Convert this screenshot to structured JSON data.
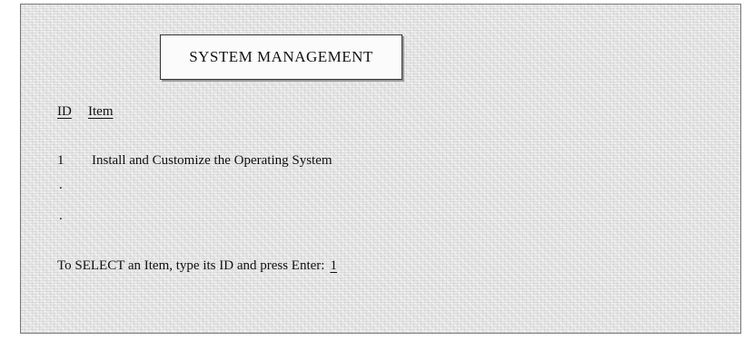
{
  "screen": {
    "title": "SYSTEM MANAGEMENT",
    "columns": {
      "id_header": "ID",
      "item_header": "Item"
    },
    "items": [
      {
        "id": "1",
        "label": "Install and Customize the Operating System"
      }
    ],
    "continuation_marks": [
      ".",
      "."
    ],
    "prompt": {
      "label": "To SELECT an Item, type its ID and press Enter:",
      "input_value": "1"
    }
  }
}
